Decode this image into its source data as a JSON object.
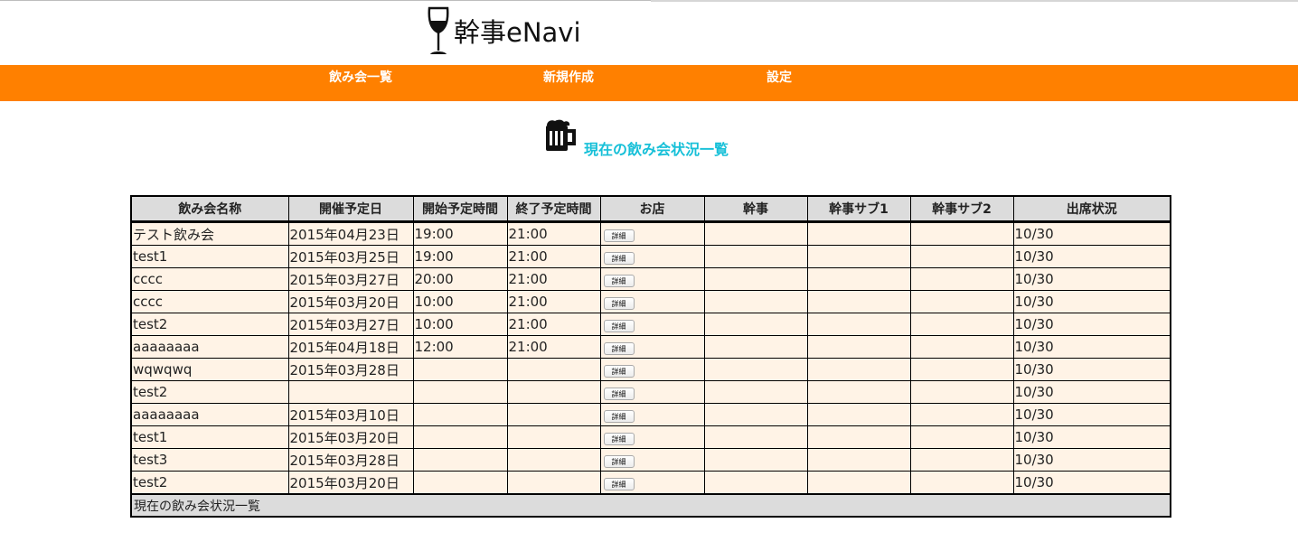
{
  "app": {
    "logo_text": "幹事eNavi"
  },
  "nav": {
    "items": [
      {
        "label": "飲み会一覧"
      },
      {
        "label": "新規作成"
      },
      {
        "label": "設定"
      }
    ]
  },
  "page": {
    "heading": "現在の飲み会状況一覧"
  },
  "table": {
    "headers": [
      "飲み会名称",
      "開催予定日",
      "開始予定時間",
      "終了予定時間",
      "お店",
      "幹事",
      "幹事サブ1",
      "幹事サブ2",
      "出席状況"
    ],
    "detail_label": "詳細",
    "rows": [
      {
        "name": "テスト飲み会",
        "date": "2015年04月23日",
        "start": "19:00",
        "end": "21:00",
        "organizer": "",
        "sub1": "",
        "sub2": "",
        "attendance": "10/30"
      },
      {
        "name": "test1",
        "date": "2015年03月25日",
        "start": "19:00",
        "end": "21:00",
        "organizer": "",
        "sub1": "",
        "sub2": "",
        "attendance": "10/30"
      },
      {
        "name": "cccc",
        "date": "2015年03月27日",
        "start": "20:00",
        "end": "21:00",
        "organizer": "",
        "sub1": "",
        "sub2": "",
        "attendance": "10/30"
      },
      {
        "name": "cccc",
        "date": "2015年03月20日",
        "start": "10:00",
        "end": "21:00",
        "organizer": "",
        "sub1": "",
        "sub2": "",
        "attendance": "10/30"
      },
      {
        "name": "test2",
        "date": "2015年03月27日",
        "start": "10:00",
        "end": "21:00",
        "organizer": "",
        "sub1": "",
        "sub2": "",
        "attendance": "10/30"
      },
      {
        "name": "aaaaaaaa",
        "date": "2015年04月18日",
        "start": "12:00",
        "end": "21:00",
        "organizer": "",
        "sub1": "",
        "sub2": "",
        "attendance": "10/30"
      },
      {
        "name": "wqwqwq",
        "date": "2015年03月28日",
        "start": "",
        "end": "",
        "organizer": "",
        "sub1": "",
        "sub2": "",
        "attendance": "10/30"
      },
      {
        "name": "test2",
        "date": "",
        "start": "",
        "end": "",
        "organizer": "",
        "sub1": "",
        "sub2": "",
        "attendance": "10/30"
      },
      {
        "name": "aaaaaaaa",
        "date": "2015年03月10日",
        "start": "",
        "end": "",
        "organizer": "",
        "sub1": "",
        "sub2": "",
        "attendance": "10/30"
      },
      {
        "name": "test1",
        "date": "2015年03月20日",
        "start": "",
        "end": "",
        "organizer": "",
        "sub1": "",
        "sub2": "",
        "attendance": "10/30"
      },
      {
        "name": "test3",
        "date": "2015年03月28日",
        "start": "",
        "end": "",
        "organizer": "",
        "sub1": "",
        "sub2": "",
        "attendance": "10/30"
      },
      {
        "name": "test2",
        "date": "2015年03月20日",
        "start": "",
        "end": "",
        "organizer": "",
        "sub1": "",
        "sub2": "",
        "attendance": "10/30"
      }
    ],
    "footer": "現在の飲み会状況一覧"
  },
  "colors": {
    "nav_bg": "#ff8000",
    "heading": "#17c0d8",
    "row_bg": "#fff3e6",
    "header_bg": "#dcdcdc"
  },
  "icons": {
    "logo": "wine-glass-icon",
    "heading": "beer-mug-icon"
  }
}
